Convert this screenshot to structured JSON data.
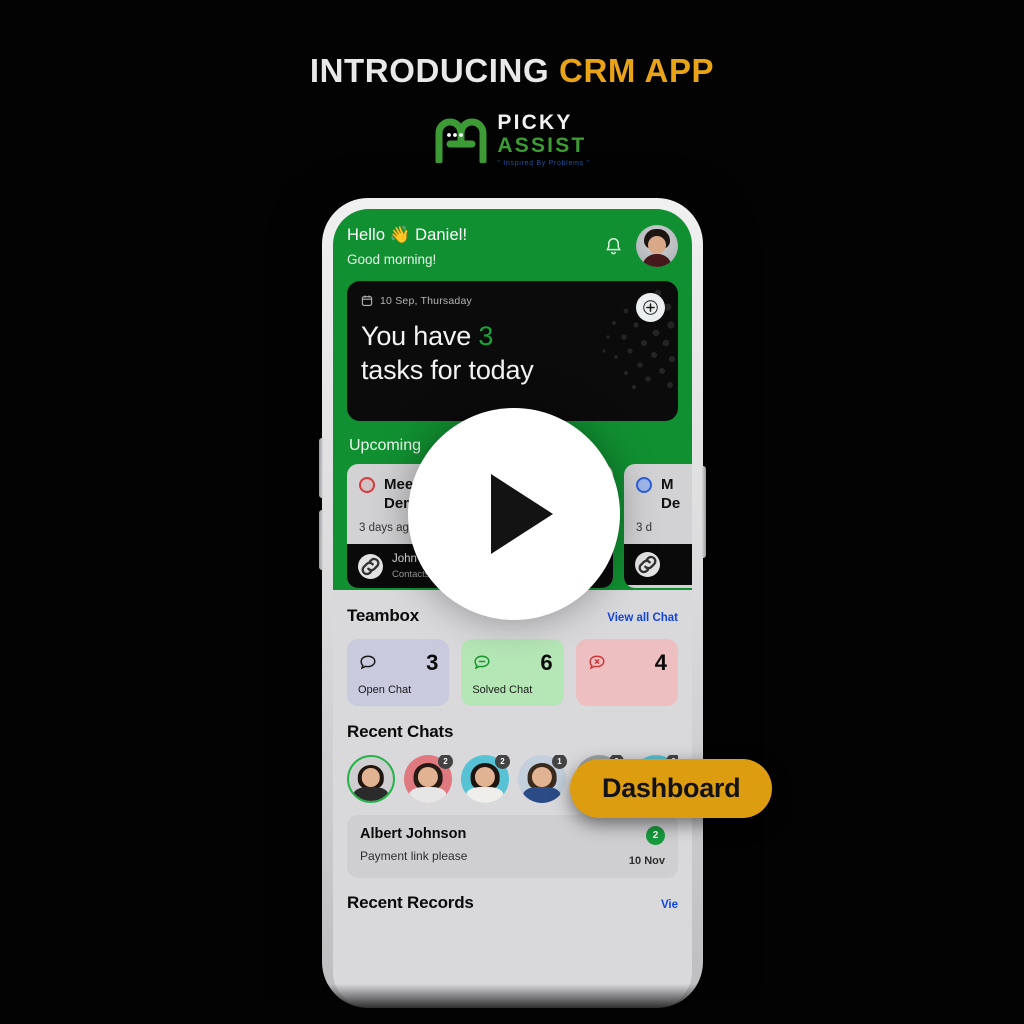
{
  "header": {
    "title_prefix": "INTRODUCING",
    "title_highlight": "CRM APP",
    "accent_color": "#e8a317"
  },
  "logo": {
    "name_top": "PICKY",
    "name_bottom": "ASSIST",
    "tagline": "\" Inspired By Problems \"",
    "mark_color": "#3d9b35"
  },
  "overlay": {
    "play_label": "play-button",
    "badge_label": "Dashboard",
    "badge_color": "#dd9d11"
  },
  "app": {
    "brand_green": "#119032",
    "greeting": {
      "hello": "Hello 👋 Daniel!",
      "subtitle": "Good morning!",
      "bell_icon": "bell-icon",
      "avatar": "user-avatar"
    },
    "task_card": {
      "date": "10 Sep, Thursaday",
      "calendar_icon": "calendar-icon",
      "headline_pre": "You have ",
      "headline_count": "3",
      "headline_post": "",
      "headline_line2": "tasks for today",
      "add_icon": "plus-icon"
    },
    "upcoming": {
      "section_label": "Upcoming",
      "cards": [
        {
          "status_color": "#d93a3a",
          "title_line1": "Meee",
          "title_line2": "Demo",
          "when": "3 days ag",
          "contact_name": "John Peter",
          "contact_type": "Contacts",
          "link_icon": "link-icon",
          "call_icon": "phone-icon",
          "view_icon": "eye-icon"
        },
        {
          "status_color": "#2d5fd9",
          "title_line1": "M",
          "title_line2": "De",
          "when": "3 d",
          "contact_name": "",
          "contact_type": "",
          "link_icon": "link-icon",
          "call_icon": "phone-icon",
          "view_icon": "eye-icon"
        }
      ]
    },
    "teambox": {
      "title": "Teambox",
      "link": "View all Chat",
      "stats": [
        {
          "icon": "chat-bubble-icon",
          "value": "3",
          "label": "Open Chat",
          "bg": "#c9cade"
        },
        {
          "icon": "chat-solved-icon",
          "value": "6",
          "label": "Solved Chat",
          "bg": "#b5e6b6"
        },
        {
          "icon": "chat-unresolved-icon",
          "value": "4",
          "label": "",
          "bg": "#edbfc1"
        }
      ]
    },
    "recent_chats": {
      "title": "Recent Chats",
      "avatars": [
        {
          "badge": "",
          "active": true,
          "hair": "#20160f",
          "shirt": "#2b2b2b",
          "bg": "#cfcfd1"
        },
        {
          "badge": "2",
          "active": false,
          "hair": "#261a14",
          "shirt": "#e6e6e6",
          "bg": "#e0797f"
        },
        {
          "badge": "2",
          "active": false,
          "hair": "#1d1410",
          "shirt": "#f0eeea",
          "bg": "#57c2d4"
        },
        {
          "badge": "1",
          "active": false,
          "hair": "#3a2a1d",
          "shirt": "#2a4b86",
          "bg": "#c3cfdc"
        },
        {
          "badge": "3",
          "active": false,
          "hair": "#231812",
          "shirt": "#dcdcdc",
          "bg": "#9fa3a6"
        },
        {
          "badge": "3",
          "active": false,
          "hair": "#1e1510",
          "shirt": "#f2f0ec",
          "bg": "#57c2d4"
        },
        {
          "badge": "",
          "active": false,
          "hair": "#2a1d15",
          "shirt": "#d8d8d8",
          "bg": "#b7babd"
        }
      ],
      "item": {
        "name": "Albert Johnson",
        "message": "Payment link please",
        "badge": "2",
        "date": "10 Nov"
      }
    },
    "recent_records": {
      "title": "Recent Records",
      "link": "Vie"
    }
  }
}
